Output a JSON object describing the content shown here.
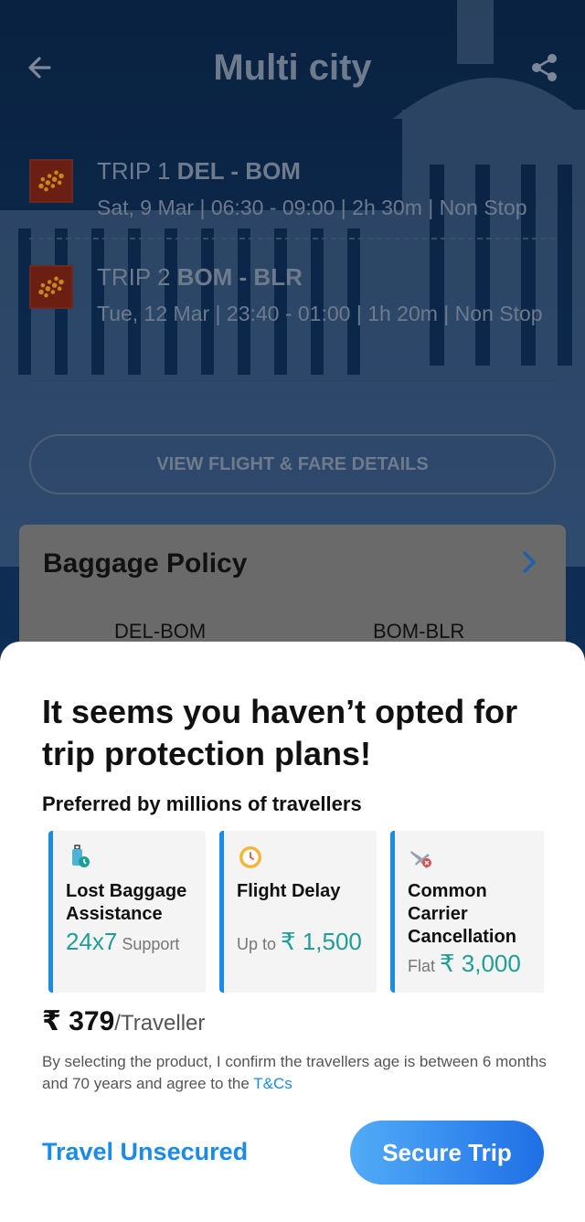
{
  "header": {
    "title": "Multi city"
  },
  "trips": [
    {
      "label": "TRIP 1",
      "route": "DEL - BOM",
      "details": "Sat, 9 Mar | 06:30 - 09:00 | 2h 30m | Non Stop"
    },
    {
      "label": "TRIP 2",
      "route": "BOM - BLR",
      "details": "Tue, 12 Mar | 23:40 - 01:00 | 1h 20m | Non Stop"
    }
  ],
  "view_details_label": "VIEW FLIGHT & FARE DETAILS",
  "baggage": {
    "title": "Baggage Policy",
    "routes": [
      "DEL-BOM",
      "BOM-BLR"
    ]
  },
  "sheet": {
    "heading": "It seems you haven’t opted for trip protection plans!",
    "subheading": "Preferred by millions of travellers",
    "plans": [
      {
        "name": "Lost Baggage Assistance",
        "prefix": "",
        "highlight": "24x7",
        "suffix": " Support",
        "icon": "luggage-icon"
      },
      {
        "name": "Flight Delay",
        "prefix": "Up to ",
        "highlight": "₹ 1,500",
        "suffix": "",
        "icon": "clock-icon"
      },
      {
        "name": "Common Carrier Cancellation",
        "prefix": "Flat ",
        "highlight": "₹ 3,000",
        "suffix": "",
        "icon": "plane-cancel-icon"
      }
    ],
    "price": {
      "amount": "₹ 379",
      "per": "/Traveller"
    },
    "disclaimer": "By selecting the product, I confirm the travellers age is between 6 months and 70 years and agree to the ",
    "tnc_label": "T&Cs",
    "unsecured_label": "Travel Unsecured",
    "secure_label": "Secure Trip"
  },
  "colors": {
    "accent": "#1a8be9",
    "highlight": "#1f9e95",
    "secure_gradient_start": "#52acf7",
    "secure_gradient_end": "#1f6fe6"
  }
}
